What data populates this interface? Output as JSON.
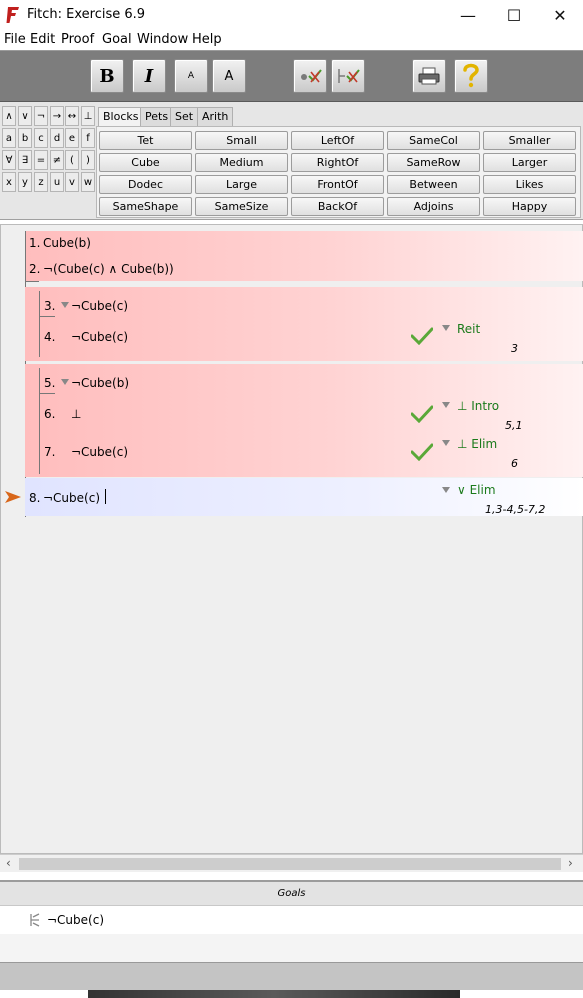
{
  "window": {
    "title": "Fitch: Exercise 6.9",
    "minimize": "—",
    "maximize": "☐",
    "close": "✕"
  },
  "menu": [
    "File",
    "Edit",
    "Proof",
    "Goal",
    "Window",
    "Help"
  ],
  "toolbar": {
    "bold": "B",
    "italic": "I",
    "small_a": "A",
    "big_a": "A"
  },
  "symbols": {
    "row1": [
      "∧",
      "∨",
      "¬",
      "→",
      "↔",
      "⊥"
    ],
    "row2": [
      "a",
      "b",
      "c",
      "d",
      "e",
      "f"
    ],
    "row3": [
      "∀",
      "∃",
      "=",
      "≠",
      "(",
      ")"
    ],
    "row4": [
      "x",
      "y",
      "z",
      "u",
      "v",
      "w"
    ]
  },
  "tabs": [
    "Blocks",
    "Pets",
    "Set",
    "Arith"
  ],
  "predicates": [
    [
      "Tet",
      "Small",
      "LeftOf",
      "SameCol",
      "Smaller"
    ],
    [
      "Cube",
      "Medium",
      "RightOf",
      "SameRow",
      "Larger"
    ],
    [
      "Dodec",
      "Large",
      "FrontOf",
      "Between",
      "Likes"
    ],
    [
      "SameShape",
      "SameSize",
      "BackOf",
      "Adjoins",
      "Happy"
    ]
  ],
  "proof": {
    "premises": [
      {
        "num": "1.",
        "text": "Cube(b)"
      },
      {
        "num": "2.",
        "text": "¬(Cube(c) ∧ Cube(b))"
      }
    ],
    "sub1": {
      "assumption": {
        "num": "3.",
        "text": "¬Cube(c)"
      },
      "steps": [
        {
          "num": "4.",
          "text": "¬Cube(c)",
          "rule": "Reit",
          "cite": "3"
        }
      ]
    },
    "sub2": {
      "assumption": {
        "num": "5.",
        "text": "¬Cube(b)"
      },
      "steps": [
        {
          "num": "6.",
          "text": "⊥",
          "rule": "⊥ Intro",
          "cite": "5,1"
        },
        {
          "num": "7.",
          "text": "¬Cube(c)",
          "rule": "⊥ Elim",
          "cite": "6"
        }
      ]
    },
    "conclusion": {
      "num": "8.",
      "text": "¬Cube(c)",
      "rule": "∨ Elim",
      "cite": "1,3-4,5-7,2"
    }
  },
  "goals": {
    "header": "Goals",
    "items": [
      {
        "text": "¬Cube(c)"
      }
    ]
  },
  "colors": {
    "pink": "#ffbdbd",
    "blue": "#e0e4ff",
    "rule_green": "#1b7a1b",
    "check_green": "#5aa838",
    "arrow_orange": "#d8661a"
  }
}
